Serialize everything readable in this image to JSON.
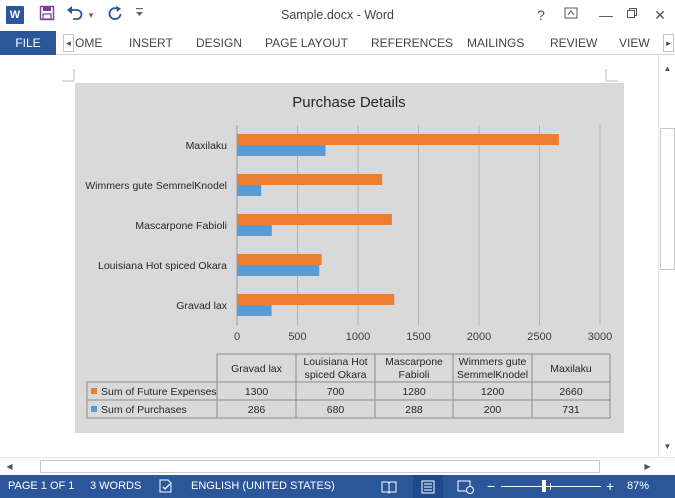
{
  "window": {
    "title": "Sample.docx - Word",
    "help": "?",
    "restore_ribbon": "⬒",
    "minimize": "—",
    "maximize": "☐",
    "close": "✕"
  },
  "quick_access": {
    "app_icon": "W",
    "save_icon": "save-icon",
    "undo_icon": "undo-icon",
    "redo_icon": "redo-icon"
  },
  "ribbon": {
    "file_tab": "FILE",
    "tabs": [
      "OME",
      "INSERT",
      "DESIGN",
      "PAGE LAYOUT",
      "REFERENCES",
      "MAILINGS",
      "REVIEW",
      "VIEW"
    ],
    "scroll_left": "◂",
    "scroll_right": "▸"
  },
  "chart_data": {
    "type": "bar",
    "orientation": "horizontal",
    "title": "Purchase Details",
    "categories": [
      "Gravad lax",
      "Louisiana Hot spiced Okara",
      "Mascarpone Fabioli",
      "Wimmers gute SemmelKnodel",
      "Maxilaku"
    ],
    "table_headers": [
      "Gravad lax",
      "Louisiana Hot\nspiced Okara",
      "Mascarpone\nFabioli",
      "Wimmers gute\nSemmelKnodel",
      "Maxilaku"
    ],
    "series": [
      {
        "name": "Sum of Future Expenses",
        "values": [
          1300,
          700,
          1280,
          1200,
          2660
        ],
        "color": "#ed7d31"
      },
      {
        "name": "Sum of Purchases",
        "values": [
          286,
          680,
          288,
          200,
          731
        ],
        "color": "#5b9bd5"
      }
    ],
    "xlim": [
      0,
      3000
    ],
    "xticks": [
      0,
      500,
      1000,
      1500,
      2000,
      2500,
      3000
    ],
    "grid": true,
    "legend_placement": "data-table"
  },
  "status_bar": {
    "page": "PAGE 1 OF 1",
    "words": "3 WORDS",
    "language": "ENGLISH (UNITED STATES)",
    "zoom_minus": "−",
    "zoom_plus": "+",
    "zoom": "87%"
  },
  "colors": {
    "accent": "#2b579a",
    "chart_background": "#d9d9d9"
  }
}
